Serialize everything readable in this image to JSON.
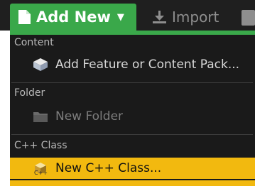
{
  "toolbar": {
    "add_new_label": "Add New",
    "import_label": "Import"
  },
  "menu": {
    "sections": [
      {
        "title": "Content",
        "items": [
          {
            "label": "Add Feature or Content Pack...",
            "icon": "content-pack-icon",
            "state": "normal"
          }
        ]
      },
      {
        "title": "Folder",
        "items": [
          {
            "label": "New Folder",
            "icon": "folder-icon",
            "state": "disabled"
          }
        ]
      },
      {
        "title": "C++ Class",
        "items": [
          {
            "label": "New C++ Class...",
            "icon": "cpp-class-icon",
            "state": "highlighted"
          }
        ]
      }
    ]
  },
  "colors": {
    "accent_green": "#3aa84a",
    "highlight_yellow": "#f2b90f",
    "menu_bg": "#1a1a1a",
    "toolbar_bg": "#1f1f1f"
  }
}
